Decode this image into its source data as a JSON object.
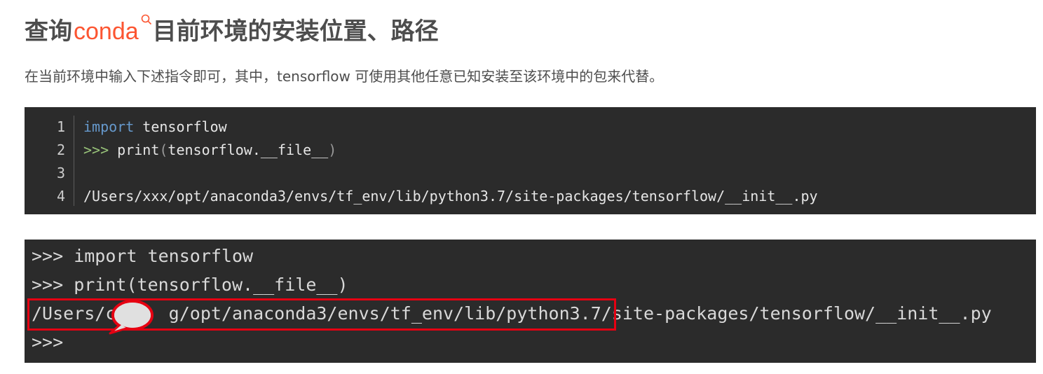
{
  "heading": {
    "prefix": "查询",
    "keyword": "conda",
    "suffix": "目前环境的安装位置、路径"
  },
  "intro": "在当前环境中输入下述指令即可，其中，tensorflow 可使用其他任意已知安装至该环境中的包来代替。",
  "code_block": {
    "line_numbers": [
      "1",
      "2",
      "3",
      "4"
    ],
    "line1_keyword": "import",
    "line1_rest": " tensorflow",
    "line2_prompt": ">>>",
    "line2_call": " print",
    "line2_open": "(",
    "line2_arg": "tensorflow.__file__",
    "line2_close": ")",
    "line3": "",
    "line4": "/Users/xxx/opt/anaconda3/envs/tf_env/lib/python3.7/site-packages/tensorflow/__init__.py"
  },
  "terminal": {
    "lines": [
      ">>> import tensorflow",
      ">>> print(tensorflow.__file__)",
      "/Users/c     g/opt/anaconda3/envs/tf_env/lib/python3.7/site-packages/tensorflow/__init__.py",
      ">>>"
    ]
  },
  "colors": {
    "keyword_accent": "#fc5531",
    "highlight_border": "#e60012",
    "code_background": "#2b2b2b"
  },
  "icons": [
    "search-icon",
    "speech-bubble-redaction"
  ]
}
